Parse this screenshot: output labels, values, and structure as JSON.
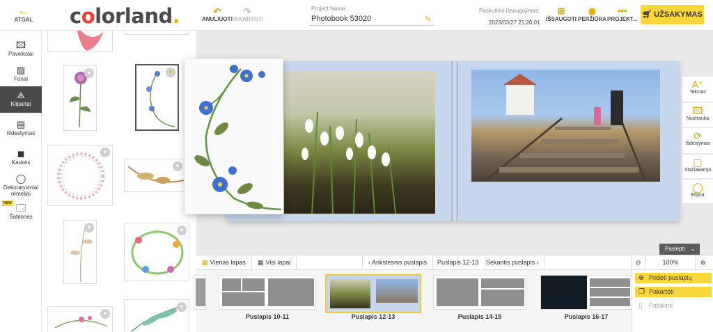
{
  "header": {
    "back_label": "ATGAL",
    "logo_text": [
      "c",
      "o",
      "lorland",
      "."
    ],
    "undo_label": "ANULIUOTI",
    "redo_label": "PAKARTOTI",
    "project_label": "Project Name:",
    "project_name": "Photobook 53020",
    "saved_label": "Paskutinis išsaugojimas:",
    "saved_time": "2023/03/27 21:20:01",
    "actions": [
      {
        "label": "IŠSAUGOTI",
        "icon": "save-plus-icon"
      },
      {
        "label": "PERŽIŪRA",
        "icon": "eye-icon"
      },
      {
        "label": "PROJEKT...",
        "icon": "more-dots-icon"
      }
    ],
    "order_label": "UŽSAKYMAS"
  },
  "rail": {
    "items": [
      {
        "label": "Paveikslai",
        "icon": "image-icon"
      },
      {
        "label": "Fonai",
        "icon": "pattern-icon"
      },
      {
        "label": "Klipartai",
        "icon": "shapes-icon"
      },
      {
        "label": "Išdėstymas",
        "icon": "layout-icon"
      },
      {
        "label": "Kaukės",
        "icon": "mask-icon"
      },
      {
        "label": "Dekoratyviniai rėmeliai",
        "icon": "frame-icon"
      },
      {
        "label": "Šablonas",
        "icon": "template-icon"
      }
    ],
    "new_badge": "NEW"
  },
  "right_tools": [
    {
      "label": "Tekstas",
      "icon": "text-add-icon"
    },
    {
      "label": "Nuotrauka",
      "icon": "photo-add-icon"
    },
    {
      "label": "Išdėstymas",
      "icon": "shuffle-icon"
    },
    {
      "label": "Stačiakampi",
      "icon": "rectangle-icon"
    },
    {
      "label": "Elipsa",
      "icon": "ellipse-icon"
    }
  ],
  "hide_label": "Paslėpti",
  "navbar": {
    "single_page": "Vienas lapas",
    "all_pages": "Visi lapai",
    "previous": "Ankstesnis puslapis",
    "current": "Puslapis 12-13",
    "next": "Sekantis puslapis",
    "zoom": "100%"
  },
  "strip": {
    "spreads": [
      "Puslapis 10-11",
      "Puslapis 12-13",
      "Puslapis 14-15",
      "Puslapis 16-17"
    ]
  },
  "context_menu": [
    {
      "label": "Pridėti puslapių",
      "state": "on"
    },
    {
      "label": "Pakartoti",
      "state": "on"
    },
    {
      "label": "Pašalinti",
      "state": "off"
    }
  ],
  "colors": {
    "accent": "#f9d73b",
    "accent_dark": "#e0a800",
    "logo_red": "#e8412c",
    "rail_active": "#4a4a4a",
    "page_blue": "#c6d6ec"
  }
}
